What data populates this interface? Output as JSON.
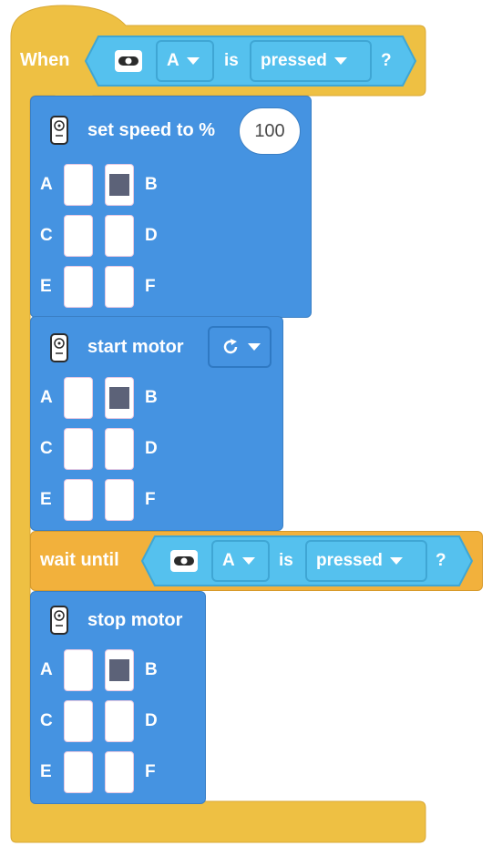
{
  "event": {
    "when_label": "When",
    "port_value": "A",
    "is_label": "is",
    "state_value": "pressed",
    "question": "?"
  },
  "set_speed": {
    "label": "set speed to %",
    "speed_value": "100",
    "ports": [
      "A",
      "B",
      "C",
      "D",
      "E",
      "F"
    ],
    "selected_port": "B"
  },
  "start_motor": {
    "label": "start motor",
    "direction_icon": "clockwise-arrow-icon",
    "ports": [
      "A",
      "B",
      "C",
      "D",
      "E",
      "F"
    ],
    "selected_port": "B"
  },
  "wait_until": {
    "label": "wait until",
    "port_value": "A",
    "is_label": "is",
    "state_value": "pressed",
    "question": "?"
  },
  "stop_motor": {
    "label": "stop motor",
    "ports": [
      "A",
      "B",
      "C",
      "D",
      "E",
      "F"
    ],
    "selected_port": "B"
  },
  "colors": {
    "event_yellow": "#eec043",
    "motor_blue": "#4593e1",
    "control_orange": "#f2b13c",
    "sensor_cyan": "#55c1ee",
    "selected_port": "#5c6278"
  }
}
